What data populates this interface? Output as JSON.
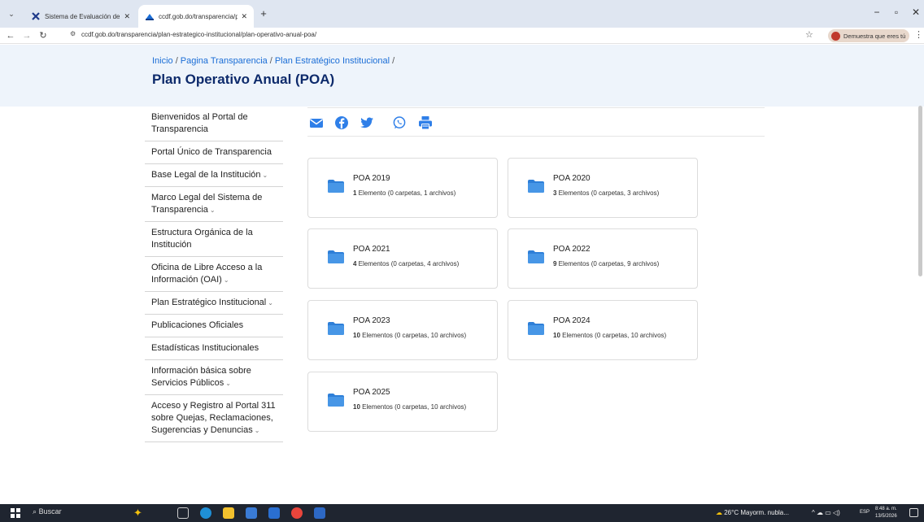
{
  "browser": {
    "tabs": [
      {
        "title": "Sistema de Evaluación de Porta",
        "active": false
      },
      {
        "title": "ccdf.gob.do/transparencia/plar",
        "active": true
      }
    ],
    "url": "ccdf.gob.do/transparencia/plan-estrategico-institucional/plan-operativo-anual-poa/",
    "profile_label": "Demuestra que eres tú"
  },
  "breadcrumb": [
    "Inicio",
    "Pagina Transparencia",
    "Plan Estratégico Institucional"
  ],
  "page_title": "Plan Operativo Anual (POA)",
  "sidebar": {
    "items": [
      {
        "label": "Bienvenidos al Portal de Transparencia",
        "chevron": false
      },
      {
        "label": "Portal Único de Transparencia",
        "chevron": false
      },
      {
        "label": "Base Legal de la Institución",
        "chevron": true
      },
      {
        "label": "Marco Legal del Sistema de Transparencia",
        "chevron": true
      },
      {
        "label": "Estructura Orgánica de la Institución",
        "chevron": false
      },
      {
        "label": "Oficina de Libre Acceso a la Información (OAI)",
        "chevron": true
      },
      {
        "label": "Plan Estratégico Institucional",
        "chevron": true
      },
      {
        "label": "Publicaciones Oficiales",
        "chevron": false
      },
      {
        "label": "Estadísticas Institucionales",
        "chevron": false
      },
      {
        "label": "Información básica sobre Servicios Públicos",
        "chevron": true
      },
      {
        "label": "Acceso y Registro al Portal 311 sobre Quejas, Reclamaciones, Sugerencias y Denuncias",
        "chevron": true
      }
    ]
  },
  "share_icons": [
    "email-icon",
    "facebook-icon",
    "twitter-icon",
    "whatsapp-icon",
    "print-icon"
  ],
  "folders": [
    {
      "name": "POA 2019",
      "count": "1",
      "rest": " Elemento (0 carpetas, 1 archivos)"
    },
    {
      "name": "POA 2020",
      "count": "3",
      "rest": " Elementos (0 carpetas, 3 archivos)"
    },
    {
      "name": "POA 2021",
      "count": "4",
      "rest": " Elementos (0 carpetas, 4 archivos)"
    },
    {
      "name": "POA 2022",
      "count": "9",
      "rest": " Elementos (0 carpetas, 9 archivos)"
    },
    {
      "name": "POA 2023",
      "count": "10",
      "rest": " Elementos (0 carpetas, 10 archivos)"
    },
    {
      "name": "POA 2024",
      "count": "10",
      "rest": " Elementos (0 carpetas, 10 archivos)"
    },
    {
      "name": "POA 2025",
      "count": "10",
      "rest": " Elementos (0 carpetas, 10 archivos)"
    }
  ],
  "colors": {
    "accent": "#1a6dd6",
    "title": "#0d2a6b",
    "hero_bg": "#eef4fb",
    "share_icon": "#2f7fe8",
    "folder": "#2e7fd8"
  },
  "taskbar": {
    "search": "Buscar",
    "weather": "26°C  Mayorm. nubla...",
    "lang": "ESP",
    "time": "8:48 a. m.",
    "date": "13/5/2026"
  }
}
